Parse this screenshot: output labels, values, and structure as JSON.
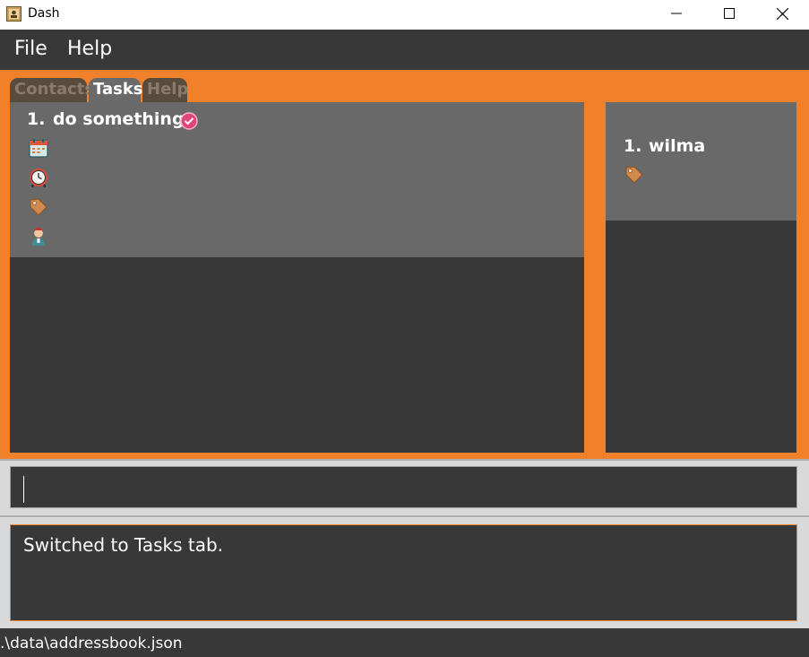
{
  "window": {
    "title": "Dash"
  },
  "menu": {
    "file": "File",
    "help": "Help"
  },
  "tabs": [
    {
      "label": "Contacts",
      "selected": false
    },
    {
      "label": "Tasks",
      "selected": true
    },
    {
      "label": "Help",
      "selected": false
    }
  ],
  "tasks": [
    {
      "index": "1.",
      "name": "do something",
      "completed": true,
      "icons": [
        "calendar-icon",
        "clock-icon",
        "tag-icon",
        "person-icon"
      ]
    }
  ],
  "people": [
    {
      "index": "1.",
      "name": "wilma",
      "icons": [
        "tag-icon"
      ]
    }
  ],
  "command": {
    "value": ""
  },
  "result": {
    "text": "Switched to Tasks tab."
  },
  "status": {
    "path": ".\\data\\addressbook.json"
  },
  "colors": {
    "accent": "#f0812a",
    "panel_dark": "#383838",
    "card": "#696969",
    "check": "#e0457b"
  }
}
